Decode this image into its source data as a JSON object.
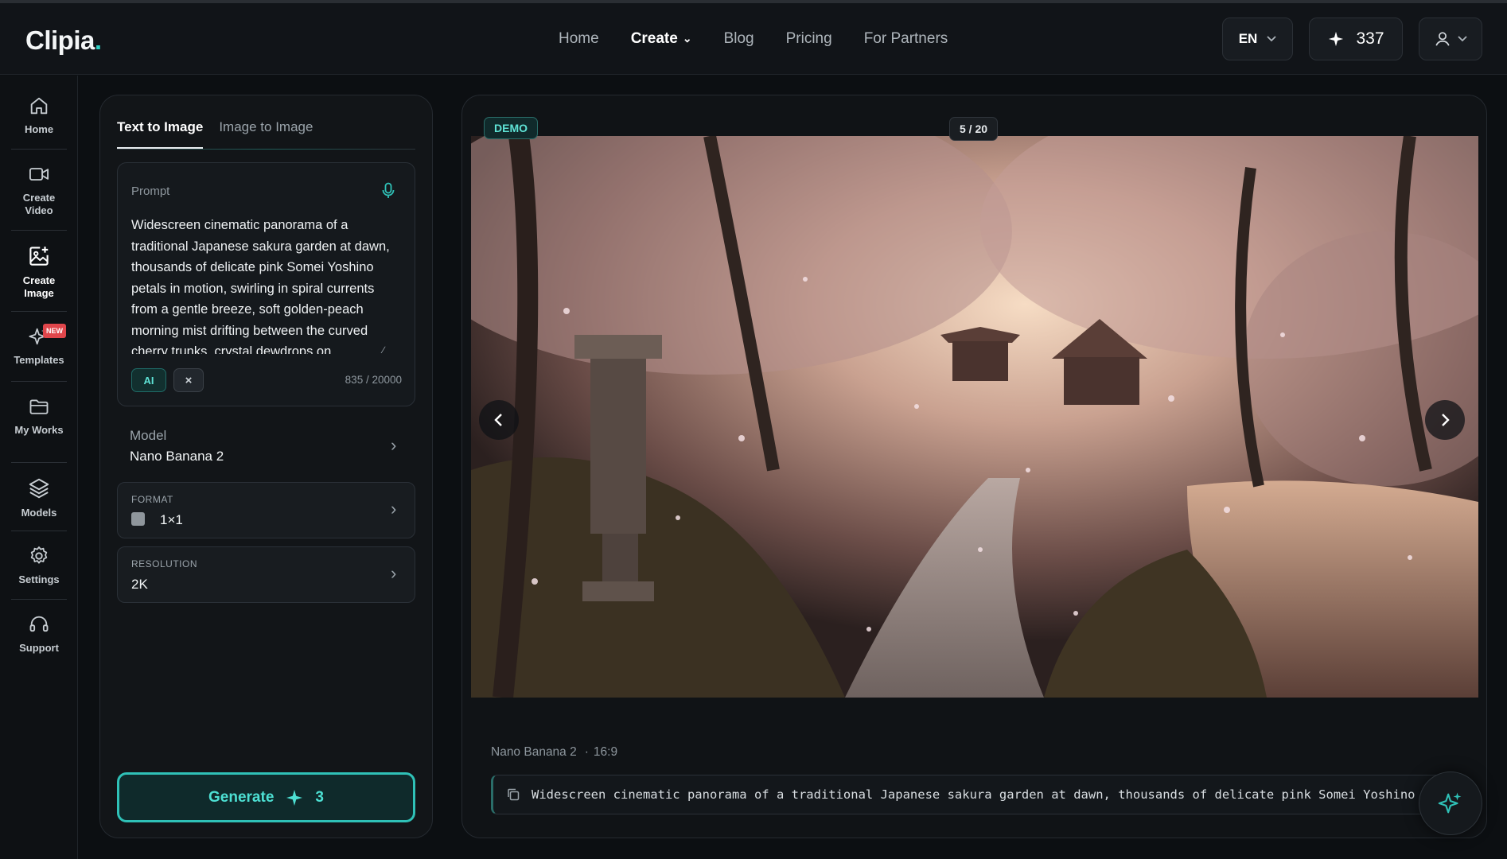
{
  "header": {
    "logo": "Clipia",
    "logo_dot": ".",
    "nav": [
      {
        "label": "Home"
      },
      {
        "label": "Create"
      },
      {
        "label": "Blog"
      },
      {
        "label": "Pricing"
      },
      {
        "label": "For Partners"
      }
    ],
    "lang": "EN",
    "credits": "337"
  },
  "sidebar": {
    "items": [
      {
        "label": "Home",
        "icon": "home-icon"
      },
      {
        "label": "Create Video",
        "icon": "video-camera-icon"
      },
      {
        "label": "Create Image",
        "icon": "image-plus-icon"
      },
      {
        "label": "Templates",
        "icon": "sparkles-icon",
        "badge": "NEW"
      },
      {
        "label": "My Works",
        "icon": "folder-icon"
      },
      {
        "label": "Models",
        "icon": "layers-icon"
      },
      {
        "label": "Settings",
        "icon": "gear-icon"
      },
      {
        "label": "Support",
        "icon": "headset-icon"
      }
    ]
  },
  "panel": {
    "tabs": [
      "Text to Image",
      "Image to Image"
    ],
    "prompt_label": "Prompt",
    "prompt_text": "Widescreen cinematic panorama of a traditional Japanese sakura garden at dawn, thousands of delicate pink Somei Yoshino petals in motion, swirling in spiral currents from a gentle breeze, soft golden-peach morning mist drifting between the curved cherry trunks, crystal dewdrops on",
    "chip_ai": "AI",
    "chip_clear": "×",
    "char_count": "835 / 20000",
    "model_label": "Model",
    "model_value": "Nano Banana 2",
    "format_label": "FORMAT",
    "format_value": "1×1",
    "resolution_label": "RESOLUTION",
    "resolution_value": "2K",
    "generate_label": "Generate",
    "generate_cost": "3"
  },
  "viewer": {
    "demo_badge": "DEMO",
    "pager": "5 / 20",
    "meta_model": "Nano Banana 2",
    "meta_ratio": "16:9",
    "prompt_preview": "Widescreen cinematic panorama of a traditional Japanese sakura garden at dawn, thousands of delicate pink Somei Yoshino petals in motion, swirling in spiral currents from a gentle breeze"
  },
  "colors": {
    "accent": "#2fc1b7",
    "background": "#0c0f12",
    "panel": "#121518"
  }
}
